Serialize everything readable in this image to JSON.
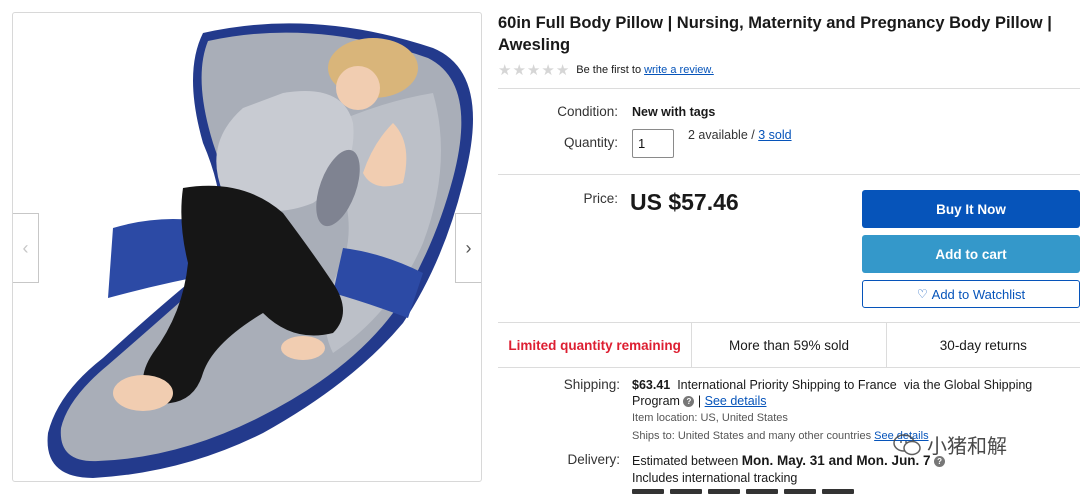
{
  "gallery": {
    "prev_arrow": "‹",
    "next_arrow": "›"
  },
  "product": {
    "title": "60in Full Body Pillow | Nursing, Maternity and Pregnancy Body Pillow | Awesling",
    "rating_text": "Be the first to",
    "review_link": "write a review."
  },
  "details": {
    "condition_label": "Condition:",
    "condition_value": "New with tags",
    "quantity_label": "Quantity:",
    "quantity_value": "1",
    "available_text": "2 available /",
    "sold_link": "3 sold"
  },
  "pricing": {
    "price_label": "Price:",
    "price_value": "US $57.46"
  },
  "actions": {
    "buy_now": "Buy It Now",
    "add_to_cart": "Add to cart",
    "watchlist": "Add to Watchlist"
  },
  "highlights": {
    "limited": "Limited quantity remaining",
    "sold_percent": "More than 59% sold",
    "returns": "30-day returns"
  },
  "shipping": {
    "label": "Shipping:",
    "cost": "$63.41",
    "service": "International Priority Shipping to France",
    "via": "via the Global Shipping Program",
    "see_details": "See details",
    "location": "Item location: US, United States",
    "ships_to": "Ships to: United States and many other countries",
    "ships_to_link": "See details"
  },
  "delivery": {
    "label": "Delivery:",
    "estimate_prefix": "Estimated between",
    "estimate_dates": "Mon. May. 31 and Mon. Jun. 7",
    "tracking": "Includes international tracking"
  },
  "watermark": {
    "text": "小猪和解"
  },
  "colors": {
    "primary_blue": "#0654ba",
    "cart_blue": "#3498ca",
    "alert_red": "#dd1e31"
  }
}
